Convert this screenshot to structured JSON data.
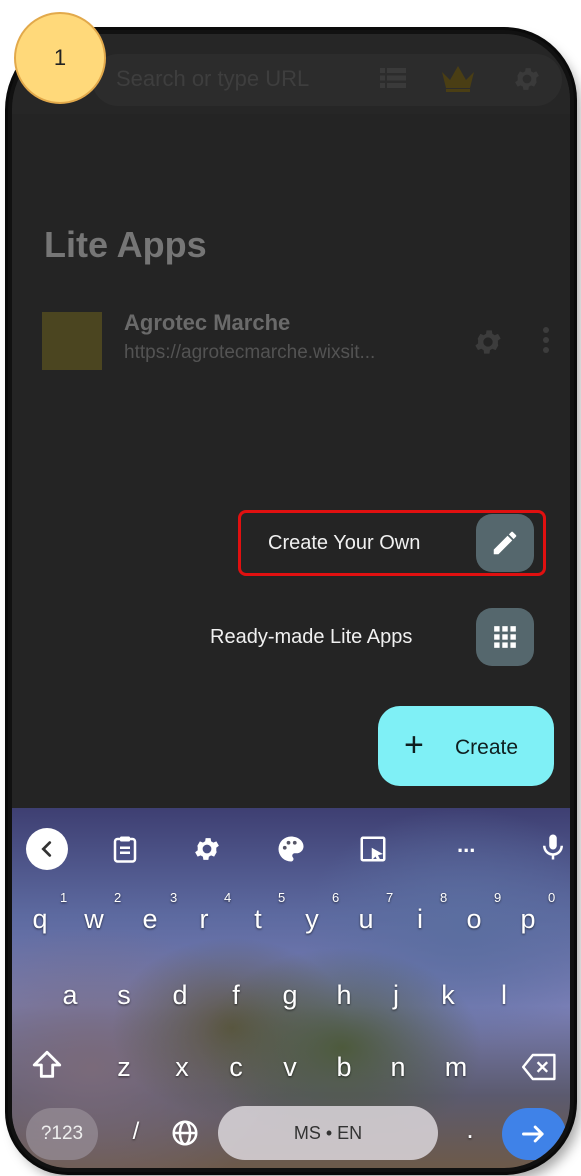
{
  "step_badge": "1",
  "topbar": {
    "search_placeholder": "Search or type URL"
  },
  "section": {
    "title": "Lite Apps"
  },
  "lite_apps": [
    {
      "name": "Agrotec Marche",
      "url": "https://agrotecmarche.wixsit..."
    }
  ],
  "fab_menu": {
    "create_own_label": "Create Your Own",
    "ready_made_label": "Ready-made Lite Apps",
    "create_label": "Create",
    "create_plus": "+"
  },
  "keyboard": {
    "row1": [
      "q",
      "w",
      "e",
      "r",
      "t",
      "y",
      "u",
      "i",
      "o",
      "p"
    ],
    "row1_hints": [
      "1",
      "2",
      "3",
      "4",
      "5",
      "6",
      "7",
      "8",
      "9",
      "0"
    ],
    "row2": [
      "a",
      "s",
      "d",
      "f",
      "g",
      "h",
      "j",
      "k",
      "l"
    ],
    "row3": [
      "z",
      "x",
      "c",
      "v",
      "b",
      "n",
      "m"
    ],
    "mode_label": "?123",
    "slash": "/",
    "period": ".",
    "space_label": "MS • EN",
    "toolbar_more": "..."
  },
  "colors": {
    "highlight": "#e01010",
    "create_fab": "#7ff0f6",
    "enter_key": "#3f82e8",
    "badge": "#ffd97a"
  }
}
